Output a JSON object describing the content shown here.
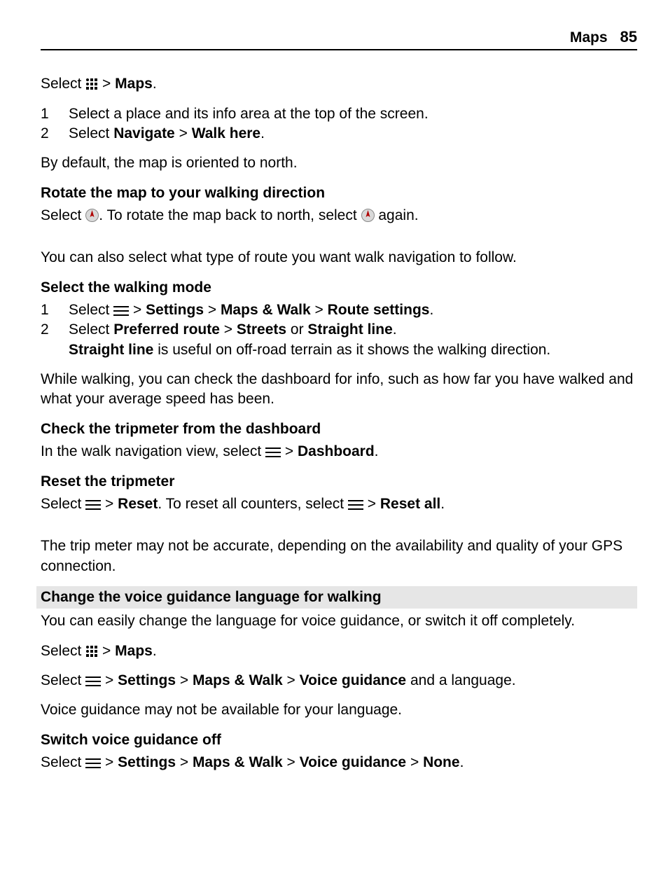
{
  "header": {
    "title": "Maps",
    "pageno": "85"
  },
  "intro": {
    "select_prefix": "Select ",
    "gt": " > ",
    "maps_bold": "Maps",
    "period": "."
  },
  "steps1": [
    "Select a place and its info area at the top of the screen.",
    {
      "prefix": "Select ",
      "bold1": "Navigate",
      "gt": " > ",
      "bold2": "Walk here",
      "suffix": "."
    }
  ],
  "default_north": "By default, the map is oriented to north.",
  "rotate": {
    "heading": "Rotate the map to your walking direction",
    "p_a": "Select ",
    "p_b": ". To rotate the map back to north, select ",
    "p_c": " again."
  },
  "route_intro": "You can also select what type of route you want walk navigation to follow.",
  "walkmode": {
    "heading": "Select the walking mode",
    "step1": {
      "prefix": "Select ",
      "gt": " > ",
      "b1": "Settings",
      "b2": "Maps & Walk",
      "b3": "Route settings",
      "suffix": "."
    },
    "step2": {
      "prefix": "Select ",
      "b1": "Preferred route",
      "gt": " > ",
      "b2": "Streets",
      "or": " or ",
      "b3": "Straight line",
      "suffix": "."
    },
    "note_bold": "Straight line",
    "note_rest": " is useful on off-road terrain as it shows the walking direction."
  },
  "dashboard_para": "While walking, you can check the dashboard for info, such as how far you have walked and what your average speed has been.",
  "tripmeter": {
    "heading": "Check the tripmeter from the dashboard",
    "p_a": "In the walk navigation view, select ",
    "gt": " > ",
    "b1": "Dashboard",
    "suffix": "."
  },
  "reset": {
    "heading": "Reset the tripmeter",
    "p_a": "Select ",
    "gt": " > ",
    "b1": "Reset",
    "p_b": ". To reset all counters, select ",
    "b2": "Reset all",
    "suffix": "."
  },
  "gps_note": "The trip meter may not be accurate, depending on the availability and quality of your GPS connection.",
  "voice": {
    "heading": "Change the voice guidance language for walking",
    "intro": "You can easily change the language for voice guidance, or switch it off completely.",
    "sel1_a": "Select ",
    "sel1_gt": " > ",
    "sel1_b": "Maps",
    "sel1_suffix": ".",
    "sel2_a": "Select ",
    "sel2_gt": " > ",
    "sel2_b1": "Settings",
    "sel2_b2": "Maps & Walk",
    "sel2_b3": "Voice guidance",
    "sel2_tail": " and a language.",
    "avail": "Voice guidance may not be available for your language."
  },
  "switchoff": {
    "heading": "Switch voice guidance off",
    "p_a": "Select ",
    "gt": " > ",
    "b1": "Settings",
    "b2": "Maps & Walk",
    "b3": "Voice guidance",
    "b4": "None",
    "suffix": "."
  }
}
